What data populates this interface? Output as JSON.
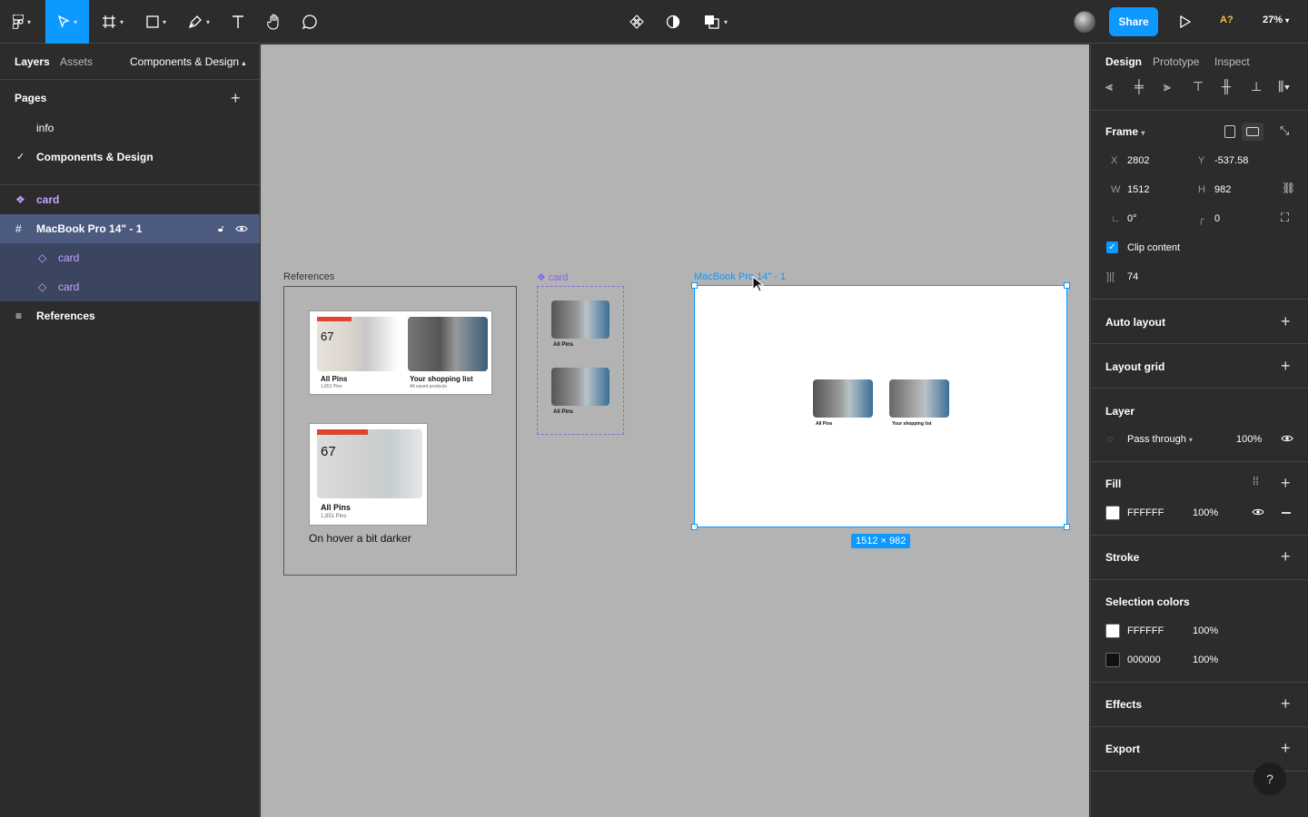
{
  "toolbar": {
    "share_label": "Share",
    "badge": "A?",
    "zoom": "27%"
  },
  "left": {
    "tabs": [
      "Layers",
      "Assets"
    ],
    "page_selector": "Components & Design",
    "pages_title": "Pages",
    "pages": [
      "info",
      "Components & Design"
    ],
    "layers": [
      {
        "label": "card"
      },
      {
        "label": "MacBook Pro 14\" - 1"
      },
      {
        "label": "card"
      },
      {
        "label": "card"
      },
      {
        "label": "References"
      }
    ]
  },
  "canvas": {
    "references_label": "References",
    "card_label": "card",
    "macbook_label": "MacBook Pro 14\" - 1",
    "hover_note": "On hover a bit darker",
    "dim_badge": "1512 × 982",
    "card_texts": {
      "number": "67",
      "all_pins": "All Pins",
      "all_pins_sub": "1,851 Pins",
      "shopping": "Your shopping list",
      "shopping_sub": "All saved products"
    }
  },
  "right": {
    "tabs": [
      "Design",
      "Prototype",
      "Inspect"
    ],
    "frame_title": "Frame",
    "x_label": "X",
    "x": "2802",
    "y_label": "Y",
    "y": "-537.58",
    "w_label": "W",
    "w": "1512",
    "h_label": "H",
    "h": "982",
    "rotation": "0°",
    "radius": "0",
    "clip_label": "Clip content",
    "spacing": "74",
    "auto_layout": "Auto layout",
    "layout_grid": "Layout grid",
    "layer_title": "Layer",
    "blend": "Pass through",
    "layer_opacity": "100%",
    "fill_title": "Fill",
    "fill_hex": "FFFFFF",
    "fill_opacity": "100%",
    "stroke_title": "Stroke",
    "selection_colors_title": "Selection colors",
    "sel_colors": [
      {
        "hex": "FFFFFF",
        "opacity": "100%",
        "color": "#ffffff"
      },
      {
        "hex": "000000",
        "opacity": "100%",
        "color": "#111111"
      }
    ],
    "effects_title": "Effects",
    "export_title": "Export",
    "help": "?"
  }
}
